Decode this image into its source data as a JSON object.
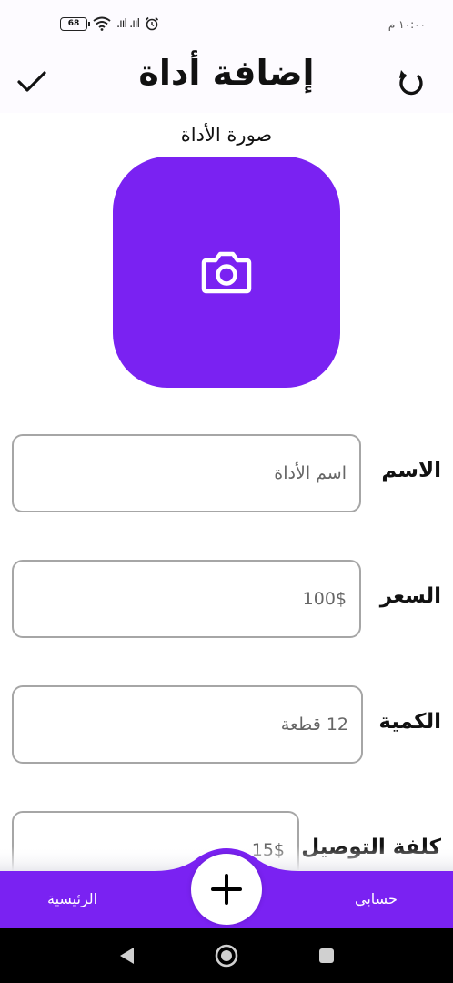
{
  "status_bar": {
    "battery": "68",
    "signal": ".ııl .ııl",
    "time": "١٠:٠٠ م"
  },
  "header": {
    "title": "إضافة أداة",
    "confirm_icon": "check-icon",
    "reset_icon": "refresh-icon"
  },
  "image_section": {
    "label": "صورة الأداة",
    "icon": "camera-icon",
    "color": "#7a22f2"
  },
  "fields": [
    {
      "label": "الاسم",
      "value": "اسم الأداة"
    },
    {
      "label": "السعر",
      "value": "100$"
    },
    {
      "label": "الكمية",
      "value": "12 قطعة"
    },
    {
      "label": "كلفة التوصيل",
      "value": "15$"
    }
  ],
  "bottom_nav": {
    "home_label": "الرئيسية",
    "account_label": "حسابي",
    "add_icon": "plus-icon",
    "color": "#7a22f2"
  },
  "system_nav": {
    "back_icon": "back-triangle-icon",
    "home_icon": "home-circle-icon",
    "recents_icon": "recents-square-icon"
  }
}
